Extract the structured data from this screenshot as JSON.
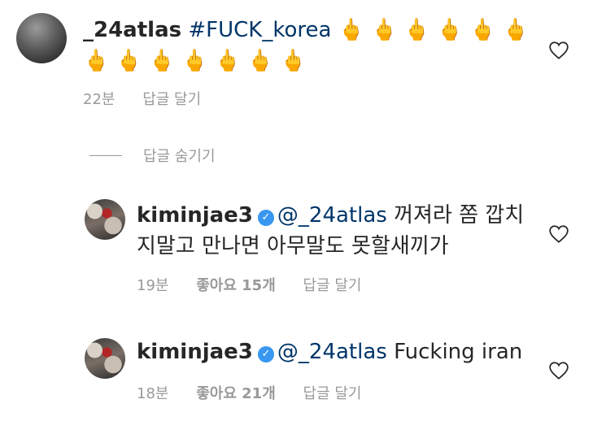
{
  "comments": [
    {
      "username": "_24atlas",
      "hashtag": "#FUCK_korea",
      "emoji_line1": "🖕🖕🖕🖕🖕🖕",
      "emoji_line2": "🖕🖕🖕🖕🖕🖕🖕",
      "time": "22분",
      "reply_label": "답글 달기"
    },
    {
      "username": "kiminjae3",
      "mention": "@_24atlas",
      "text_line1": "꺼져라 쫌 깝치",
      "text_line2": "지말고 만나면 아무말도 못할새끼가",
      "time": "19분",
      "likes": "좋아요 15개",
      "reply_label": "답글 달기"
    },
    {
      "username": "kiminjae3",
      "mention": "@_24atlas",
      "text_line1": "Fucking iran",
      "time": "18분",
      "likes": "좋아요 21개",
      "reply_label": "답글 달기"
    }
  ],
  "hide_replies_label": "답글 숨기기",
  "icons": {
    "verified": "verified-badge-icon",
    "like": "heart-icon"
  },
  "colors": {
    "link": "#003569",
    "meta": "#999999",
    "verified": "#3897f0"
  }
}
